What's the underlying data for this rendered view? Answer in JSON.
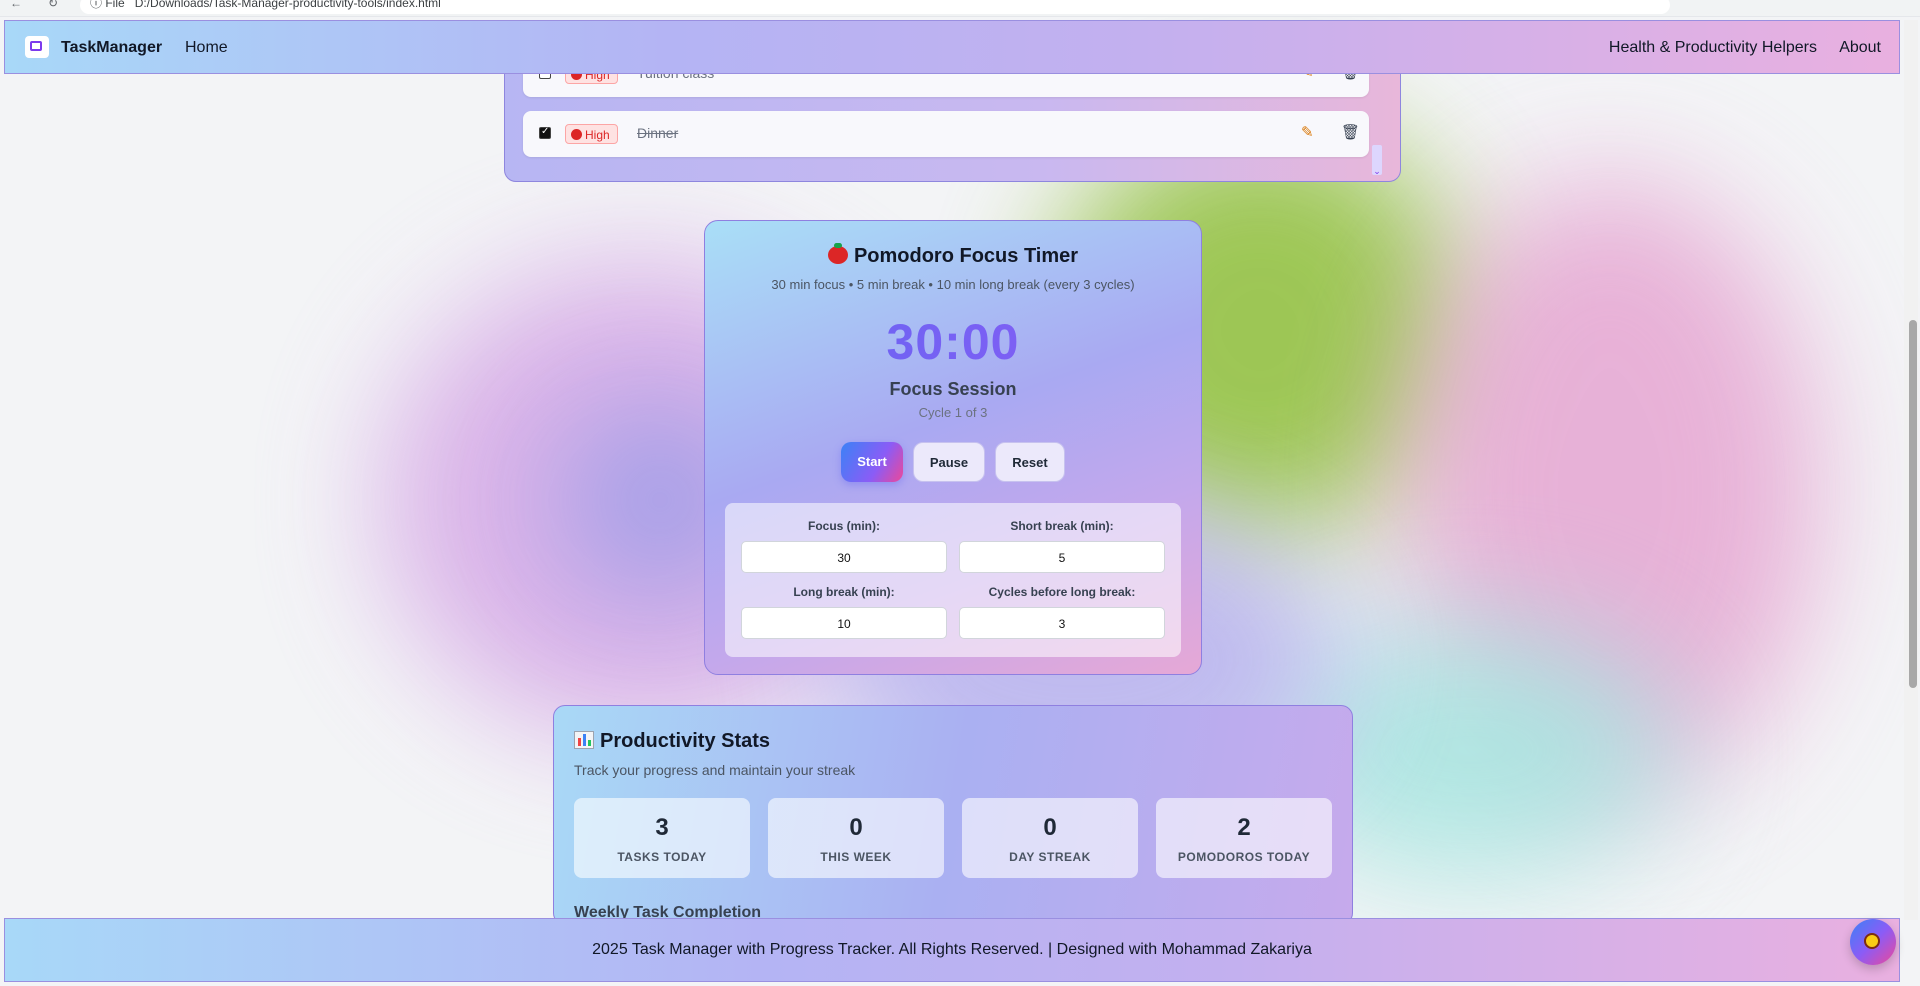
{
  "browser": {
    "url": "D:/Downloads/Task-Manager-productivity-tools/index.html",
    "file_label": "File"
  },
  "navbar": {
    "brand": "TaskManager",
    "home": "Home",
    "health": "Health & Productivity Helpers",
    "about": "About"
  },
  "tasks": [
    {
      "priority": "High",
      "title": "Tuition class",
      "done": false
    },
    {
      "priority": "High",
      "title": "Dinner",
      "done": true
    }
  ],
  "pomodoro": {
    "title": "Pomodoro Focus Timer",
    "subtitle": "30 min focus • 5 min break • 10 min long break (every 3 cycles)",
    "time": "30:00",
    "session": "Focus Session",
    "cycle": "Cycle 1 of 3",
    "buttons": {
      "start": "Start",
      "pause": "Pause",
      "reset": "Reset"
    },
    "settings": {
      "focus_label": "Focus (min):",
      "focus_value": "30",
      "short_label": "Short break (min):",
      "short_value": "5",
      "long_label": "Long break (min):",
      "long_value": "10",
      "cycles_label": "Cycles before long break:",
      "cycles_value": "3"
    }
  },
  "stats": {
    "title": "Productivity Stats",
    "subtitle": "Track your progress and maintain your streak",
    "items": [
      {
        "value": "3",
        "label": "TASKS TODAY"
      },
      {
        "value": "0",
        "label": "THIS WEEK"
      },
      {
        "value": "0",
        "label": "DAY STREAK"
      },
      {
        "value": "2",
        "label": "POMODOROS TODAY"
      }
    ],
    "weekly_heading": "Weekly Task Completion"
  },
  "footer": {
    "text": "2025 Task Manager with Progress Tracker. All Rights Reserved. | Designed with Mohammad Zakariya"
  },
  "colors": {
    "accent_purple": "#8b5cf6",
    "priority_high": "#dc2626",
    "timer_gradient_start": "#6366f1"
  }
}
